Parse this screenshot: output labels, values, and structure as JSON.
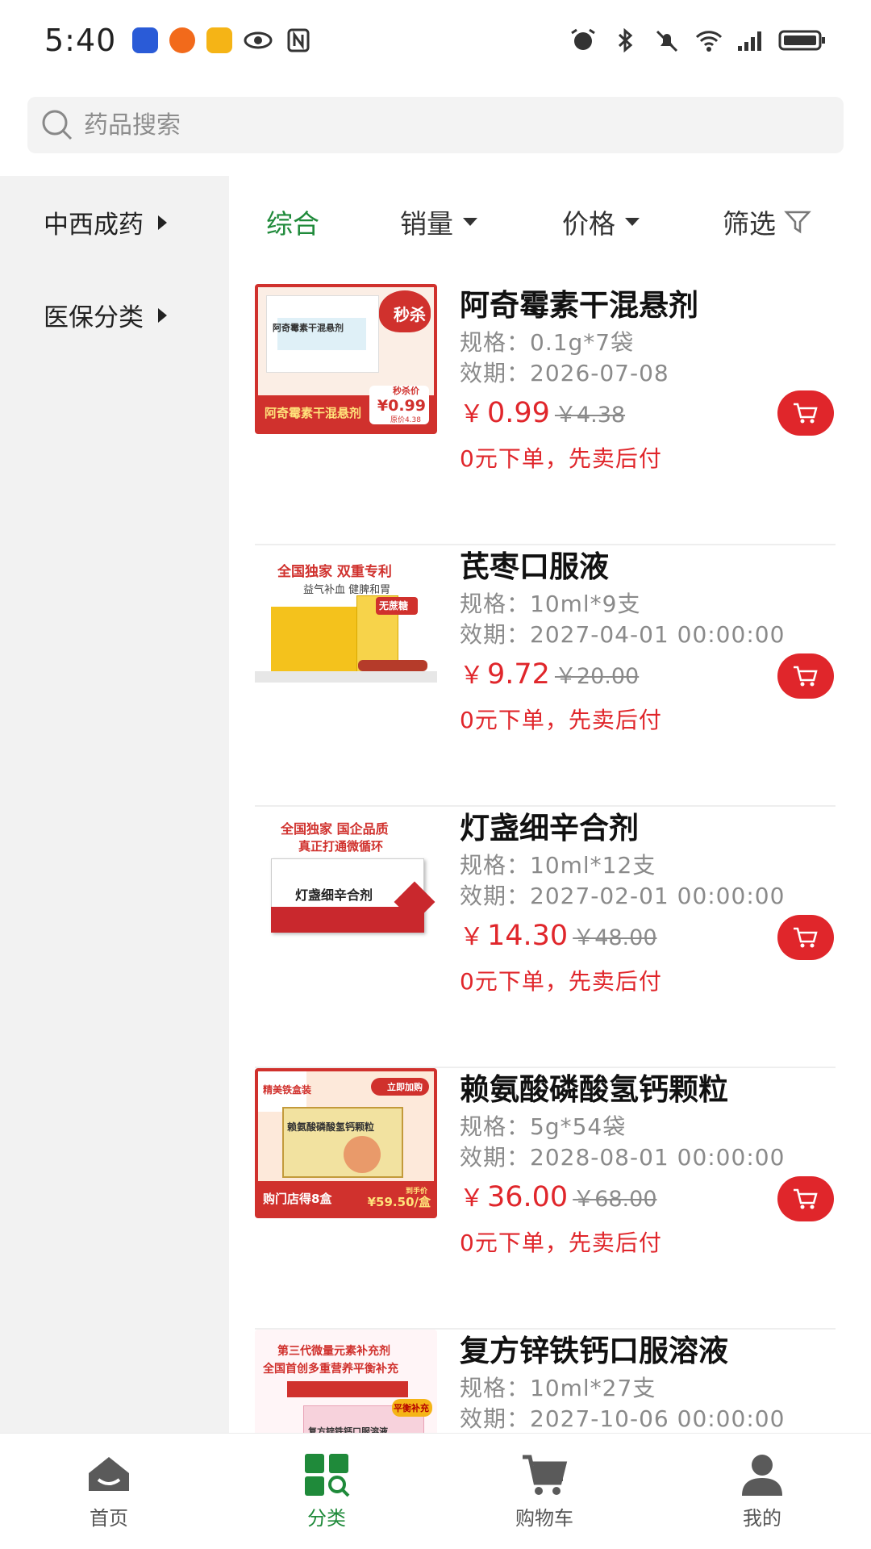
{
  "status_bar": {
    "time": "5:40"
  },
  "search": {
    "placeholder": "药品搜索"
  },
  "sidebar": {
    "items": [
      {
        "label": "中西成药"
      },
      {
        "label": "医保分类"
      }
    ]
  },
  "sort_bar": {
    "items": [
      {
        "label": "综合",
        "active": true
      },
      {
        "label": "销量"
      },
      {
        "label": "价格"
      },
      {
        "label": "筛选"
      }
    ]
  },
  "products": [
    {
      "name": "阿奇霉素干混悬剂",
      "spec": "规格：0.1g*7袋",
      "expiry": "效期：2026-07-08",
      "currency": "￥",
      "price": "0.99",
      "orig_price": "￥4.38",
      "promo": "0元下单，先卖后付",
      "thumb": {
        "tag": "秒杀",
        "name": "阿奇霉素干混悬剂",
        "price_label": "秒杀价",
        "price": "¥0.99",
        "orig": "原价4.38"
      }
    },
    {
      "name": "芪枣口服液",
      "spec": "规格：10ml*9支",
      "expiry": "效期：2027-04-01 00:00:00",
      "currency": "￥",
      "price": "9.72",
      "orig_price": "￥20.00",
      "promo": "0元下单，先卖后付",
      "thumb": {
        "line1": "全国独家 双重专利",
        "line2": "益气补血 健脾和胃",
        "badge": "无蔗糖"
      }
    },
    {
      "name": "灯盏细辛合剂",
      "spec": "规格：10ml*12支",
      "expiry": "效期：2027-02-01 00:00:00",
      "currency": "￥",
      "price": "14.30",
      "orig_price": "￥48.00",
      "promo": "0元下单，先卖后付",
      "thumb": {
        "line1": "全国独家 国企品质",
        "line2": "真正打通微循环",
        "box": "灯盏细辛合剂"
      }
    },
    {
      "name": "赖氨酸磷酸氢钙颗粒",
      "spec": "规格：5g*54袋",
      "expiry": "效期：2028-08-01 00:00:00",
      "currency": "￥",
      "price": "36.00",
      "orig_price": "￥68.00",
      "promo": "0元下单，先卖后付",
      "thumb": {
        "tag": "精美铁盒装",
        "buy": "立即加购",
        "box": "赖氨酸磷酸氢钙颗粒",
        "bottom": "购门店得8盒",
        "price_label": "到手价",
        "price": "¥59.50/盒"
      }
    },
    {
      "name": "复方锌铁钙口服溶液",
      "spec": "规格：10ml*27支",
      "expiry": "效期：2027-10-06 00:00:00",
      "currency": "￥",
      "price": "",
      "orig_price": "",
      "promo": "",
      "thumb": {
        "line1": "第三代微量元素补充剂",
        "line2": "全国首创多重营养平衡补充",
        "badge": "平衡补充",
        "box": "复方锌铁钙口服溶液"
      }
    }
  ],
  "bottom_nav": [
    {
      "label": "首页",
      "icon": "home-icon"
    },
    {
      "label": "分类",
      "icon": "category-icon",
      "active": true
    },
    {
      "label": "购物车",
      "icon": "cart-icon"
    },
    {
      "label": "我的",
      "icon": "profile-icon"
    }
  ],
  "colors": {
    "accent_green": "#1f8a3a",
    "price_red": "#e0262b",
    "sidebar_bg": "#f2f2f2"
  }
}
